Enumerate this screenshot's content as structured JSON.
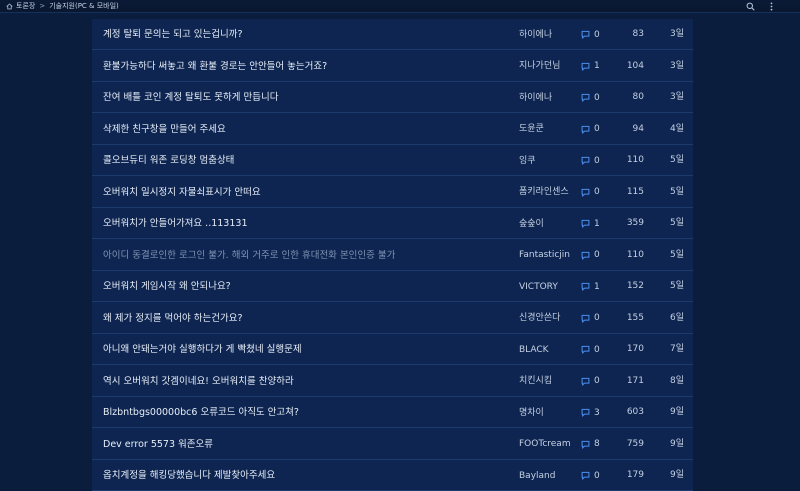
{
  "breadcrumb": {
    "home": "토론장",
    "section": "기술지원(PC & 모바일)"
  },
  "posts": [
    {
      "title": "계정 탈퇴 문의는 되고 있는겁니까?",
      "author": "하이에나",
      "comments": "0",
      "views": "83",
      "date": "3일",
      "dim": false
    },
    {
      "title": "환불가능하다 써놓고 왜 환불 경로는 안안들어 놓는거죠?",
      "author": "지나가던님",
      "comments": "1",
      "views": "104",
      "date": "3일",
      "dim": false
    },
    {
      "title": "잔여 배틀 코인 계정 탈퇴도 못하게 만듭니다",
      "author": "하이에나",
      "comments": "0",
      "views": "80",
      "date": "3일",
      "dim": false
    },
    {
      "title": "삭제한 친구창을 만들어 주세요",
      "author": "도윤쿤",
      "comments": "0",
      "views": "94",
      "date": "4일",
      "dim": false
    },
    {
      "title": "콜오브듀티 워존 로딩창 멈춤상태",
      "author": "잉쿠",
      "comments": "0",
      "views": "110",
      "date": "5일",
      "dim": false
    },
    {
      "title": "오버워치 일시정지 자물쇠표시가 안떠요",
      "author": "폼키라인센스",
      "comments": "0",
      "views": "115",
      "date": "5일",
      "dim": false
    },
    {
      "title": "오버워치가 안들어가져요 ..113131",
      "author": "숲숲이",
      "comments": "1",
      "views": "359",
      "date": "5일",
      "dim": false
    },
    {
      "title": "아이디 동결로인한 로그인 불가. 해외 거주로 인한 휴대전화 본인인증 불가",
      "author": "Fantasticjin",
      "comments": "0",
      "views": "110",
      "date": "5일",
      "dim": true
    },
    {
      "title": "오버워치 게임시작 왜 안되나요?",
      "author": "VICTORY",
      "comments": "1",
      "views": "152",
      "date": "5일",
      "dim": false
    },
    {
      "title": "왜 제가 정지를 먹어야 하는건가요?",
      "author": "신경안쓴다",
      "comments": "0",
      "views": "155",
      "date": "6일",
      "dim": false
    },
    {
      "title": "아니왜 안돼는거야 실행하다가 게 빡쳤네 실행문제",
      "author": "BLACK",
      "comments": "0",
      "views": "170",
      "date": "7일",
      "dim": false
    },
    {
      "title": "역시 오버워치 갓겜이네요! 오버워치를 찬양하라",
      "author": "치킨시킴",
      "comments": "0",
      "views": "171",
      "date": "8일",
      "dim": false
    },
    {
      "title": "Blzbntbgs00000bc6 오류코드 아직도 안고쳐?",
      "author": "명차이",
      "comments": "3",
      "views": "603",
      "date": "9일",
      "dim": false
    },
    {
      "title": "Dev error 5573 워존오류",
      "author": "FOOTcream",
      "comments": "8",
      "views": "759",
      "date": "9일",
      "dim": false
    },
    {
      "title": "옵치계정을 해킹당했습니다 제발찾아주세요",
      "author": "Bayland",
      "comments": "0",
      "views": "179",
      "date": "9일",
      "dim": false
    }
  ]
}
